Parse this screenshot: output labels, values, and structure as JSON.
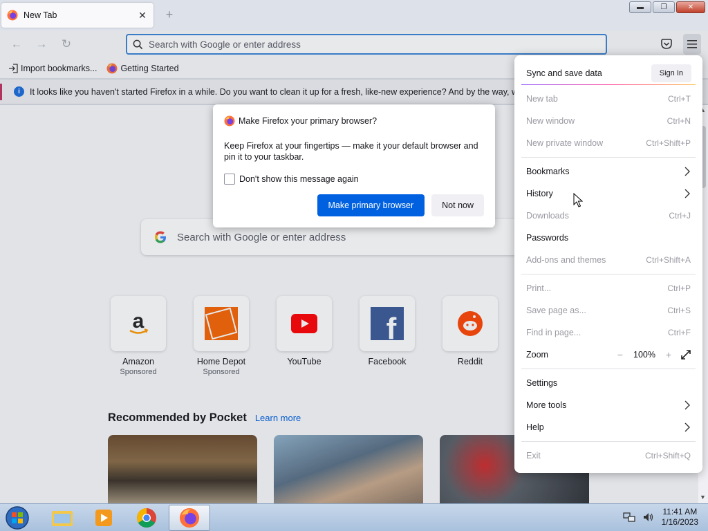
{
  "window": {
    "controls": [
      "minimize",
      "restore",
      "close"
    ]
  },
  "tab": {
    "title": "New Tab",
    "icon": "firefox-icon"
  },
  "toolbar": {
    "url_placeholder": "Search with Google or enter address",
    "zoom": "100%"
  },
  "bookmarks": [
    {
      "label": "Import bookmarks...",
      "icon": "import-icon"
    },
    {
      "label": "Getting Started",
      "icon": "firefox-icon"
    }
  ],
  "notification": {
    "text": "It looks like you haven't started Firefox in a while. Do you want to clean it up for a fresh, like-new experience? And by the way, welcome back!"
  },
  "page": {
    "search_placeholder": "Search with Google or enter address",
    "tiles": [
      {
        "label": "Amazon",
        "sub": "Sponsored",
        "icon": "amazon-icon"
      },
      {
        "label": "Home Depot",
        "sub": "Sponsored",
        "icon": "home-depot-icon"
      },
      {
        "label": "YouTube",
        "sub": "",
        "icon": "youtube-icon"
      },
      {
        "label": "Facebook",
        "sub": "",
        "icon": "facebook-icon"
      },
      {
        "label": "Reddit",
        "sub": "",
        "icon": "reddit-icon"
      }
    ],
    "pocket_title": "Recommended by Pocket",
    "pocket_link": "Learn more"
  },
  "dialog": {
    "title": "Make Firefox your primary browser?",
    "body": "Keep Firefox at your fingertips — make it your default browser and pin it to your taskbar.",
    "checkbox_label": "Don't show this message again",
    "checkbox_checked": false,
    "primary_button": "Make primary browser",
    "secondary_button": "Not now"
  },
  "menu": {
    "sync_label": "Sync and save data",
    "sign_in": "Sign In",
    "items": [
      {
        "label": "New tab",
        "shortcut": "Ctrl+T",
        "disabled": true
      },
      {
        "label": "New window",
        "shortcut": "Ctrl+N",
        "disabled": true
      },
      {
        "label": "New private window",
        "shortcut": "Ctrl+Shift+P",
        "disabled": true
      },
      {
        "label": "Bookmarks",
        "shortcut": "",
        "disabled": false,
        "submenu": true
      },
      {
        "label": "History",
        "shortcut": "",
        "disabled": false,
        "submenu": true
      },
      {
        "label": "Downloads",
        "shortcut": "Ctrl+J",
        "disabled": true
      },
      {
        "label": "Passwords",
        "shortcut": "",
        "disabled": false
      },
      {
        "label": "Add-ons and themes",
        "shortcut": "Ctrl+Shift+A",
        "disabled": true
      },
      {
        "label": "Print...",
        "shortcut": "Ctrl+P",
        "disabled": true
      },
      {
        "label": "Save page as...",
        "shortcut": "Ctrl+S",
        "disabled": true
      },
      {
        "label": "Find in page...",
        "shortcut": "Ctrl+F",
        "disabled": true
      },
      {
        "label": "Zoom",
        "shortcut": "",
        "disabled": false
      },
      {
        "label": "Settings",
        "shortcut": "",
        "disabled": false
      },
      {
        "label": "More tools",
        "shortcut": "",
        "disabled": false,
        "submenu": true
      },
      {
        "label": "Help",
        "shortcut": "",
        "disabled": false,
        "submenu": true
      },
      {
        "label": "Exit",
        "shortcut": "Ctrl+Shift+Q",
        "disabled": true
      }
    ],
    "zoom_minus": "−",
    "zoom_plus": "+"
  },
  "taskbar": {
    "apps": [
      "internet-explorer-icon",
      "file-explorer-icon",
      "media-player-icon",
      "chrome-icon",
      "firefox-icon"
    ],
    "time": "11:41 AM",
    "date": "1/16/2023"
  },
  "colors": {
    "accent": "#0061e0",
    "focus_ring": "#3b83d7",
    "notification_stripe": "#c1325f"
  }
}
